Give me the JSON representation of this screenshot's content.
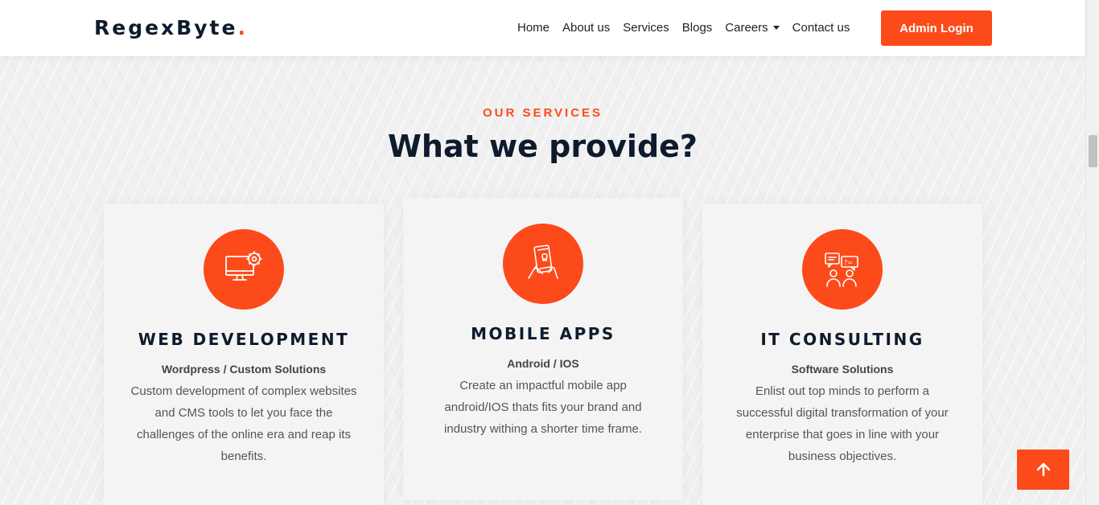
{
  "brand": {
    "name": "RegexByte",
    "dot": ".",
    "accent": "#fc4a1a"
  },
  "nav": {
    "items": [
      {
        "label": "Home"
      },
      {
        "label": "About us"
      },
      {
        "label": "Services"
      },
      {
        "label": "Blogs"
      },
      {
        "label": "Careers",
        "dropdown": true
      },
      {
        "label": "Contact us"
      }
    ],
    "admin_label": "Admin Login"
  },
  "section": {
    "eyebrow": "OUR SERVICES",
    "title": "What we provide?"
  },
  "services": [
    {
      "icon": "monitor-gear-icon",
      "title": "WEB DEVELOPMENT",
      "subtitle": "Wordpress / Custom Solutions",
      "description": "Custom development of complex websites and CMS tools to let you face the challenges of the online era and reap its benefits."
    },
    {
      "icon": "mobile-hands-icon",
      "title": "MOBILE APPS",
      "subtitle": "Android / IOS",
      "description": "Create an impactful mobile app android/IOS thats fits your brand and industry withing a shorter time frame."
    },
    {
      "icon": "consulting-people-icon",
      "title": "IT CONSULTING",
      "subtitle": "Software Solutions",
      "description": "Enlist out top minds to perform a successful digital transformation of your enterprise that goes in line with your business objectives."
    }
  ],
  "scroll_top": {
    "icon": "arrow-up-icon"
  }
}
